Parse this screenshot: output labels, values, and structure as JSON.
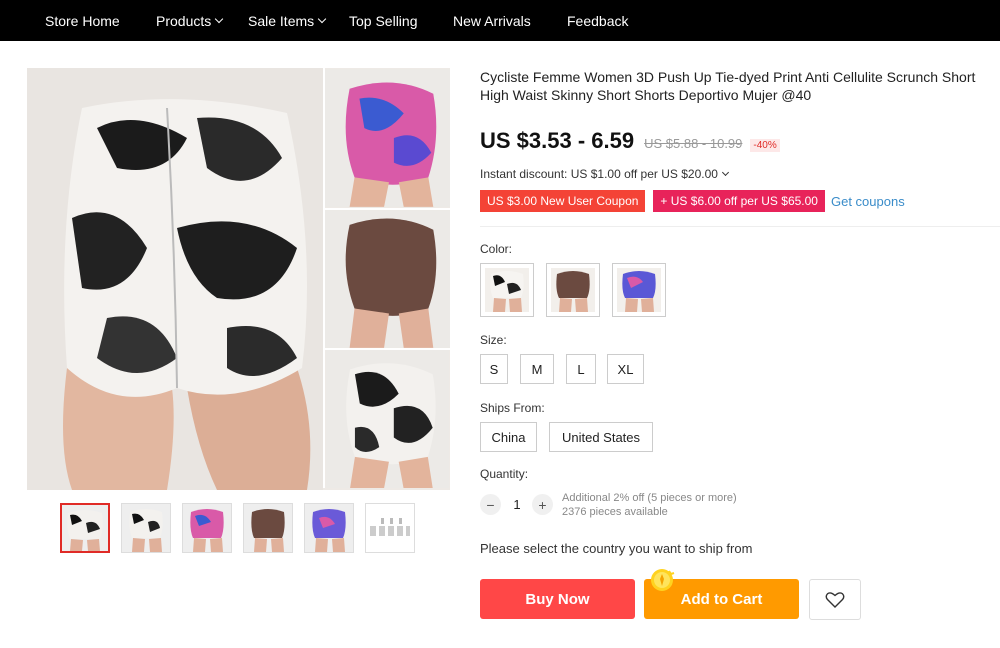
{
  "nav": {
    "items": [
      {
        "label": "Store Home",
        "dropdown": false
      },
      {
        "label": "Products",
        "dropdown": true
      },
      {
        "label": "Sale Items",
        "dropdown": true
      },
      {
        "label": "Top Selling",
        "dropdown": false
      },
      {
        "label": "New Arrivals",
        "dropdown": false
      },
      {
        "label": "Feedback",
        "dropdown": false
      }
    ]
  },
  "product": {
    "title": "Cycliste Femme Women 3D Push Up Tie-dyed Print Anti Cellulite Scrunch Short High Waist Skinny Short Shorts Deportivo Mujer @40",
    "price": "US $3.53 - 6.59",
    "old_price": "US $5.88 - 10.99",
    "discount": "-40%",
    "instant_discount": "Instant discount: US $1.00 off per US $20.00",
    "coupons": {
      "new_user": "US $3.00 New User Coupon",
      "store": "+ US $6.00 off per US $65.00",
      "get_link": "Get coupons"
    }
  },
  "options": {
    "color_label": "Color:",
    "colors": [
      "black-white-tie-dye",
      "brown",
      "blue-pink-tie-dye"
    ],
    "size_label": "Size:",
    "sizes": [
      "S",
      "M",
      "L",
      "XL"
    ],
    "ships_label": "Ships From:",
    "ships_from": [
      "China",
      "United States"
    ]
  },
  "quantity": {
    "label": "Quantity:",
    "minus": "−",
    "plus": "+",
    "value": "1",
    "additional": "Additional 2% off (5 pieces or more)",
    "available": "2376 pieces available"
  },
  "ship_note": "Please select the country you want to ship from",
  "actions": {
    "buy_now": "Buy Now",
    "add_to_cart": "Add to Cart",
    "wishlist_icon": "heart-icon"
  },
  "colors": {
    "buy": "#ff4747",
    "cart": "#ff9a00",
    "coupon_red": "#f44336",
    "coupon_pink": "#e8235a",
    "link": "#3a8cc9"
  }
}
